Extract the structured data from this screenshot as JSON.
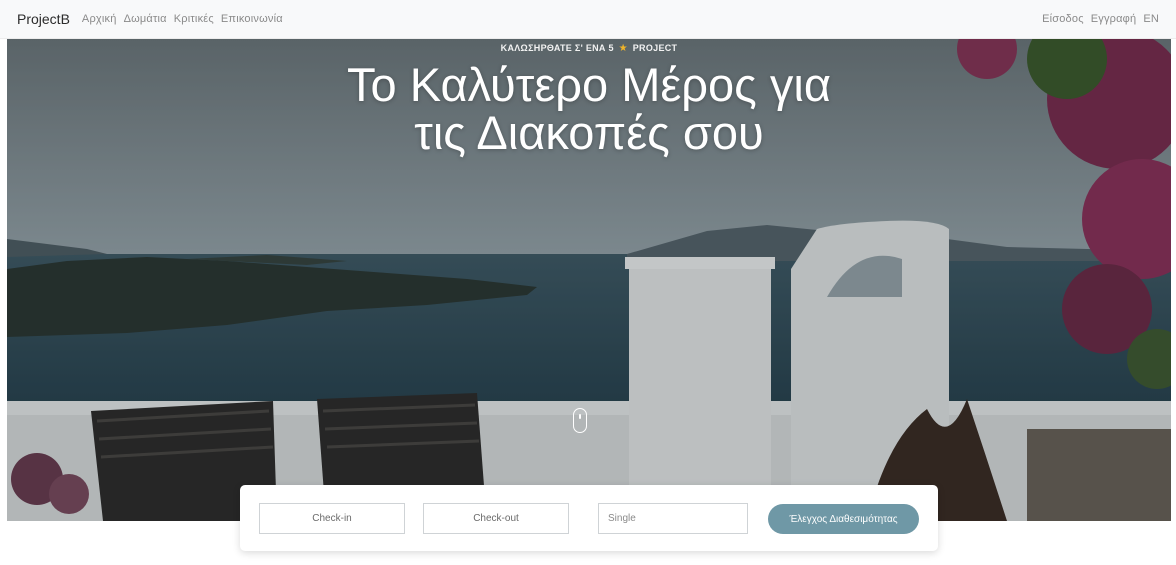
{
  "navbar": {
    "brand": "ProjectB",
    "links": [
      "Αρχική",
      "Δωμάτια",
      "Κριτικές",
      "Επικοινωνία"
    ],
    "right_links": [
      "Είσοδος",
      "Εγγραφή",
      "EN"
    ]
  },
  "hero": {
    "welcome_prefix": "ΚΑΛΩΣΗΡΘΑΤΕ Σ' ΕΝΑ 5",
    "welcome_suffix": "PROJECT",
    "title_line1": "Το Καλύτερο Μέρος για",
    "title_line2": "τις Διακοπές σου",
    "icons": [
      "star-icon",
      "scroll-down-icon"
    ],
    "accent_star": "#f0b429"
  },
  "booking": {
    "checkin_placeholder": "Check-in",
    "checkout_placeholder": "Check-out",
    "room_type_value": "Single",
    "check_button_label": "Έλεγχος Διαθεσιμότητας",
    "button_color": "#6f98a6"
  }
}
